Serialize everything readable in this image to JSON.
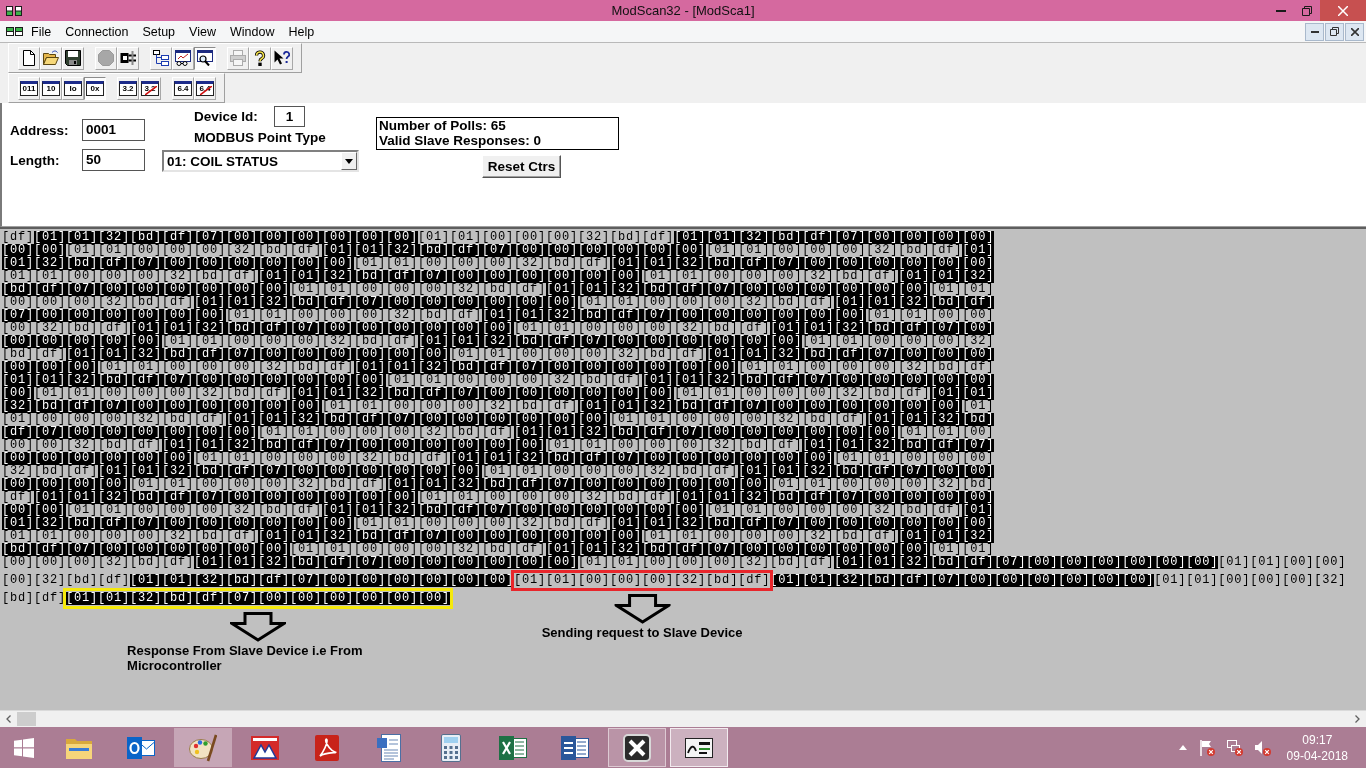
{
  "window": {
    "title": "ModScan32 - [ModSca1]"
  },
  "menu": [
    "File",
    "Connection",
    "Setup",
    "View",
    "Window",
    "Help"
  ],
  "toolbar": {
    "groups": [
      {
        "buttons": [
          {
            "kind": "new",
            "disabled": false,
            "selected": false
          },
          {
            "kind": "open",
            "disabled": false,
            "selected": false
          },
          {
            "kind": "save",
            "disabled": false,
            "selected": false
          }
        ]
      },
      {
        "buttons": [
          {
            "kind": "connect",
            "disabled": true,
            "selected": false
          },
          {
            "kind": "disconnect",
            "disabled": false,
            "selected": false
          }
        ]
      },
      {
        "buttons": [
          {
            "kind": "tree",
            "disabled": false,
            "selected": false
          },
          {
            "kind": "graph",
            "disabled": false,
            "selected": false
          },
          {
            "kind": "monitor",
            "disabled": false,
            "selected": true
          }
        ]
      },
      {
        "buttons": [
          {
            "kind": "print",
            "disabled": true,
            "selected": false
          },
          {
            "kind": "help",
            "disabled": false,
            "selected": false
          },
          {
            "kind": "context-help",
            "disabled": false,
            "selected": false
          }
        ]
      }
    ]
  },
  "format_toolbar": {
    "groups": [
      {
        "buttons": [
          {
            "label": "011",
            "selected": false,
            "crossed": false
          },
          {
            "label": "10",
            "selected": false,
            "crossed": false
          },
          {
            "label": "Io",
            "selected": false,
            "crossed": false
          },
          {
            "label": "0x",
            "selected": true,
            "crossed": false
          }
        ]
      },
      {
        "buttons": [
          {
            "label": "3.2",
            "selected": false,
            "crossed": false
          },
          {
            "label": "3.2",
            "selected": false,
            "crossed": true
          }
        ]
      },
      {
        "buttons": [
          {
            "label": "6.4",
            "selected": false,
            "crossed": false
          },
          {
            "label": "6.4",
            "selected": false,
            "crossed": true
          }
        ]
      }
    ]
  },
  "settings": {
    "address_label": "Address:",
    "address": "0001",
    "length_label": "Length:",
    "length": "50",
    "device_id_label": "Device Id:",
    "device_id": "1",
    "point_type_label": "MODBUS Point Type",
    "point_type": "01: COIL STATUS"
  },
  "counters": {
    "polls": "Number of Polls: 65",
    "valid_responses": "Valid Slave Responses: 0",
    "reset_button": "Reset Ctrs"
  },
  "traffic": {
    "rows": [
      {
        "segments": [
          {
            "text": "[df]",
            "highlighted": false
          },
          {
            "text": "[01][01][32][bd][df][07][00][00][00][00][00][00]",
            "highlighted": true
          },
          {
            "text": "[01][01][00][00][00][32][bd][df]",
            "highlighted": false
          },
          {
            "text": "[01][01][32][bd][df][07][00][00][00][00]",
            "highlighted": true
          }
        ]
      },
      {
        "segments": [
          {
            "text": "[00][00]",
            "highlighted": true
          },
          {
            "text": "[01][01][00][00][00][32][bd][df]",
            "highlighted": false
          },
          {
            "text": "[01][01][32][bd][df][07][00][00][00][00][00][00]",
            "highlighted": true
          },
          {
            "text": "[01][01][00][00][00][32][bd][df]",
            "highlighted": false
          },
          {
            "text": "[01]",
            "highlighted": true
          }
        ]
      },
      {
        "segments": [
          {
            "text": "[01][32][bd][df][07][00][00][00][00][00][00]",
            "highlighted": true
          },
          {
            "text": "[01][01][00][00][00][32][bd][df]",
            "highlighted": false
          },
          {
            "text": "[01][01][32][bd][df][07][00][00][00][00][00][00]",
            "highlighted": true
          }
        ]
      },
      {
        "segments": [
          {
            "text": "[01][01][00][00][00][32][bd][df]",
            "highlighted": false
          },
          {
            "text": "[01][01][32][bd][df][07][00][00][00][00][00][00]",
            "highlighted": true
          },
          {
            "text": "[01][01][00][00][00][32][bd][df]",
            "highlighted": false
          },
          {
            "text": "[01][01][32]",
            "highlighted": true
          }
        ]
      },
      {
        "segments": [
          {
            "text": "[bd][df][07][00][00][00][00][00][00]",
            "highlighted": true
          },
          {
            "text": "[01][01][00][00][00][32][bd][df]",
            "highlighted": false
          },
          {
            "text": "[01][01][32][bd][df][07][00][00][00][00][00][00]",
            "highlighted": true
          },
          {
            "text": "[01][01]",
            "highlighted": false
          }
        ]
      },
      {
        "segments": [
          {
            "text": "[00][00][00][32][bd][df]",
            "highlighted": false
          },
          {
            "text": "[01][01][32][bd][df][07][00][00][00][00][00][00]",
            "highlighted": true
          },
          {
            "text": "[01][01][00][00][00][32][bd][df]",
            "highlighted": false
          },
          {
            "text": "[01][01][32][bd][df]",
            "highlighted": true
          }
        ]
      },
      {
        "segments": [
          {
            "text": "[07][00][00][00][00][00][00]",
            "highlighted": true
          },
          {
            "text": "[01][01][00][00][00][32][bd][df]",
            "highlighted": false
          },
          {
            "text": "[01][01][32][bd][df][07][00][00][00][00][00][00]",
            "highlighted": true
          },
          {
            "text": "[01][01][00][00]",
            "highlighted": false
          }
        ]
      },
      {
        "segments": [
          {
            "text": "[00][32][bd][df]",
            "highlighted": false
          },
          {
            "text": "[01][01][32][bd][df][07][00][00][00][00][00][00]",
            "highlighted": true
          },
          {
            "text": "[01][01][00][00][00][32][bd][df]",
            "highlighted": false
          },
          {
            "text": "[01][01][32][bd][df][07][00]",
            "highlighted": true
          }
        ]
      },
      {
        "segments": [
          {
            "text": "[00][00][00][00][00]",
            "highlighted": true
          },
          {
            "text": "[01][01][00][00][00][32][bd][df]",
            "highlighted": false
          },
          {
            "text": "[01][01][32][bd][df][07][00][00][00][00][00][00]",
            "highlighted": true
          },
          {
            "text": "[01][01][00][00][00][32]",
            "highlighted": false
          }
        ]
      },
      {
        "segments": [
          {
            "text": "[bd][df]",
            "highlighted": false
          },
          {
            "text": "[01][01][32][bd][df][07][00][00][00][00][00][00]",
            "highlighted": true
          },
          {
            "text": "[01][01][00][00][00][32][bd][df]",
            "highlighted": false
          },
          {
            "text": "[01][01][32][bd][df][07][00][00][00]",
            "highlighted": true
          }
        ]
      },
      {
        "segments": [
          {
            "text": "[00][00][00]",
            "highlighted": true
          },
          {
            "text": "[01][01][00][00][00][32][bd][df]",
            "highlighted": false
          },
          {
            "text": "[01][01][32][bd][df][07][00][00][00][00][00][00]",
            "highlighted": true
          },
          {
            "text": "[01][01][00][00][00][32][bd][df]",
            "highlighted": false
          }
        ]
      },
      {
        "segments": [
          {
            "text": "[01][01][32][bd][df][07][00][00][00][00][00][00]",
            "highlighted": true
          },
          {
            "text": "[01][01][00][00][00][32][bd][df]",
            "highlighted": false
          },
          {
            "text": "[01][01][32][bd][df][07][00][00][00][00][00]",
            "highlighted": true
          }
        ]
      },
      {
        "segments": [
          {
            "text": "[00]",
            "highlighted": true
          },
          {
            "text": "[01][01][00][00][00][32][bd][df]",
            "highlighted": false
          },
          {
            "text": "[01][01][32][bd][df][07][00][00][00][00][00][00]",
            "highlighted": true
          },
          {
            "text": "[01][01][00][00][00][32][bd][df]",
            "highlighted": false
          },
          {
            "text": "[01][01]",
            "highlighted": true
          }
        ]
      },
      {
        "segments": [
          {
            "text": "[32][bd][df][07][00][00][00][00][00][00]",
            "highlighted": true
          },
          {
            "text": "[01][01][00][00][00][32][bd][df]",
            "highlighted": false
          },
          {
            "text": "[01][01][32][bd][df][07][00][00][00][00][00][00]",
            "highlighted": true
          },
          {
            "text": "[01]",
            "highlighted": false
          }
        ]
      },
      {
        "segments": [
          {
            "text": "[01][00][00][00][32][bd][df]",
            "highlighted": false
          },
          {
            "text": "[01][01][32][bd][df][07][00][00][00][00][00][00]",
            "highlighted": true
          },
          {
            "text": "[01][01][00][00][00][32][bd][df]",
            "highlighted": false
          },
          {
            "text": "[01][01][32][bd]",
            "highlighted": true
          }
        ]
      },
      {
        "segments": [
          {
            "text": "[df][07][00][00][00][00][00][00]",
            "highlighted": true
          },
          {
            "text": "[01][01][00][00][00][32][bd][df]",
            "highlighted": false
          },
          {
            "text": "[01][01][32][bd][df][07][00][00][00][00][00][00]",
            "highlighted": true
          },
          {
            "text": "[01][01][00]",
            "highlighted": false
          }
        ]
      },
      {
        "segments": [
          {
            "text": "[00][00][32][bd][df]",
            "highlighted": false
          },
          {
            "text": "[01][01][32][bd][df][07][00][00][00][00][00][00]",
            "highlighted": true
          },
          {
            "text": "[01][01][00][00][00][32][bd][df]",
            "highlighted": false
          },
          {
            "text": "[01][01][32][bd][df][07]",
            "highlighted": true
          }
        ]
      },
      {
        "segments": [
          {
            "text": "[00][00][00][00][00][00]",
            "highlighted": true
          },
          {
            "text": "[01][01][00][00][00][32][bd][df]",
            "highlighted": false
          },
          {
            "text": "[01][01][32][bd][df][07][00][00][00][00][00][00]",
            "highlighted": true
          },
          {
            "text": "[01][01][00][00][00]",
            "highlighted": false
          }
        ]
      },
      {
        "segments": [
          {
            "text": "[32][bd][df]",
            "highlighted": false
          },
          {
            "text": "[01][01][32][bd][df][07][00][00][00][00][00][00]",
            "highlighted": true
          },
          {
            "text": "[01][01][00][00][00][32][bd][df]",
            "highlighted": false
          },
          {
            "text": "[01][01][32][bd][df][07][00][00]",
            "highlighted": true
          }
        ]
      },
      {
        "segments": [
          {
            "text": "[00][00][00][00]",
            "highlighted": true
          },
          {
            "text": "[01][01][00][00][00][32][bd][df]",
            "highlighted": false
          },
          {
            "text": "[01][01][32][bd][df][07][00][00][00][00][00][00]",
            "highlighted": true
          },
          {
            "text": "[01][01][00][00][00][32][bd]",
            "highlighted": false
          }
        ]
      },
      {
        "segments": [
          {
            "text": "[df]",
            "highlighted": false
          },
          {
            "text": "[01][01][32][bd][df][07][00][00][00][00][00][00]",
            "highlighted": true
          },
          {
            "text": "[01][01][00][00][00][32][bd][df]",
            "highlighted": false
          },
          {
            "text": "[01][01][32][bd][df][07][00][00][00][00]",
            "highlighted": true
          }
        ]
      },
      {
        "segments": [
          {
            "text": "[00][00]",
            "highlighted": true
          },
          {
            "text": "[01][01][00][00][00][32][bd][df]",
            "highlighted": false
          },
          {
            "text": "[01][01][32][bd][df][07][00][00][00][00][00][00]",
            "highlighted": true
          },
          {
            "text": "[01][01][00][00][00][32][bd][df]",
            "highlighted": false
          },
          {
            "text": "[01]",
            "highlighted": true
          }
        ]
      },
      {
        "segments": [
          {
            "text": "[01][32][bd][df][07][00][00][00][00][00][00]",
            "highlighted": true
          },
          {
            "text": "[01][01][00][00][00][32][bd][df]",
            "highlighted": false
          },
          {
            "text": "[01][01][32][bd][df][07][00][00][00][00][00][00]",
            "highlighted": true
          }
        ]
      },
      {
        "segments": [
          {
            "text": "[01][01][00][00][00][32][bd][df]",
            "highlighted": false
          },
          {
            "text": "[01][01][32][bd][df][07][00][00][00][00][00][00]",
            "highlighted": true
          },
          {
            "text": "[01][01][00][00][00][32][bd][df]",
            "highlighted": false
          },
          {
            "text": "[01][01][32]",
            "highlighted": true
          }
        ]
      },
      {
        "segments": [
          {
            "text": "[bd][df][07][00][00][00][00][00][00]",
            "highlighted": true
          },
          {
            "text": "[01][01][00][00][00][32][bd][df]",
            "highlighted": false
          },
          {
            "text": "[01][01][32][bd][df][07][00][00][00][00][00][00]",
            "highlighted": true
          },
          {
            "text": "[01][01]",
            "highlighted": false
          }
        ]
      },
      {
        "segments": [
          {
            "text": "[00][00][00][32][bd][df]",
            "highlighted": false
          },
          {
            "text": "[01][01][32][bd][df][07][00][00][00][00][00][00]",
            "highlighted": true
          },
          {
            "text": "[01][01][00][00][00][32][bd][df]",
            "highlighted": false
          },
          {
            "text": "[01][01][32][bd][df][07][00][00][00][00][00][00]",
            "highlighted": true
          },
          {
            "text": "[01][01][00][00]",
            "highlighted": false
          }
        ]
      },
      {
        "segments": [
          {
            "text": "[00][32][bd][df]",
            "highlighted": false
          },
          {
            "text": "[01][01][32][bd][df][07][00][00][00][00][00][00]",
            "highlighted": true
          },
          {
            "text": "[01][01][00][00][00][32][bd][df]",
            "highlighted": false,
            "annotation": {
              "color": "#e8262b",
              "label": "Sending request to Slave Device"
            }
          },
          {
            "text": "[01][01][32][bd][df][07][00][00][00][00][00][00]",
            "highlighted": true
          },
          {
            "text": "[01][01][00][00][00][32]",
            "highlighted": false
          }
        ]
      },
      {
        "segments": [
          {
            "text": "[bd][df]",
            "highlighted": false
          },
          {
            "text": "[01][01][32][bd][df][07][00][00][00][00][00][00]",
            "highlighted": true,
            "annotation": {
              "color": "#f5e90c",
              "label": "Response From Slave Device i.e From Microcontroller"
            }
          }
        ]
      }
    ]
  },
  "taskbar": {
    "apps": [
      {
        "kind": "folder",
        "running": false,
        "highlighted": false
      },
      {
        "kind": "mail",
        "running": false,
        "highlighted": false
      },
      {
        "kind": "palette",
        "running": false,
        "highlighted": true
      },
      {
        "kind": "chip",
        "running": false,
        "highlighted": false
      },
      {
        "kind": "pdf",
        "running": false,
        "highlighted": false
      },
      {
        "kind": "document",
        "running": false,
        "highlighted": false
      },
      {
        "kind": "calculator",
        "running": false,
        "highlighted": false
      },
      {
        "kind": "spreadsheet",
        "running": false,
        "highlighted": false
      },
      {
        "kind": "writer",
        "running": false,
        "highlighted": false
      },
      {
        "kind": "cross",
        "running": true,
        "highlighted": false
      },
      {
        "kind": "terminal",
        "running": true,
        "highlighted": true
      }
    ],
    "clock": {
      "time": "09:17",
      "date": "09-04-2018"
    }
  }
}
